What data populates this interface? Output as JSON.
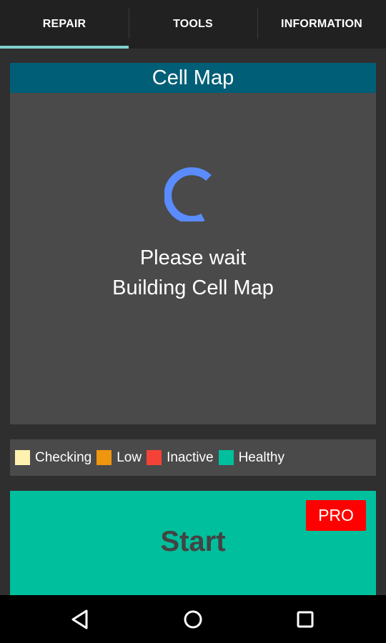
{
  "tabs": [
    {
      "label": "REPAIR"
    },
    {
      "label": "TOOLS"
    },
    {
      "label": "INFORMATION"
    }
  ],
  "cell_map": {
    "title": "Cell Map",
    "status_line1": "Please wait",
    "status_line2": "Building Cell Map"
  },
  "legend": [
    {
      "label": "Checking",
      "color": "#fff1b0"
    },
    {
      "label": "Low",
      "color": "#ef9610"
    },
    {
      "label": "Inactive",
      "color": "#f44336"
    },
    {
      "label": "Healthy",
      "color": "#00bf9c"
    }
  ],
  "start": {
    "label": "Start",
    "badge": "PRO"
  },
  "navbar": {
    "back_icon": "back-triangle-icon",
    "home_icon": "home-circle-icon",
    "recents_icon": "recents-square-icon"
  },
  "colors": {
    "accent": "#005e77",
    "spinner": "#5a8cff",
    "tab_indicator": "#7fd0cf",
    "start_bg": "#00bf9c",
    "pro_bg": "#ff0000"
  }
}
